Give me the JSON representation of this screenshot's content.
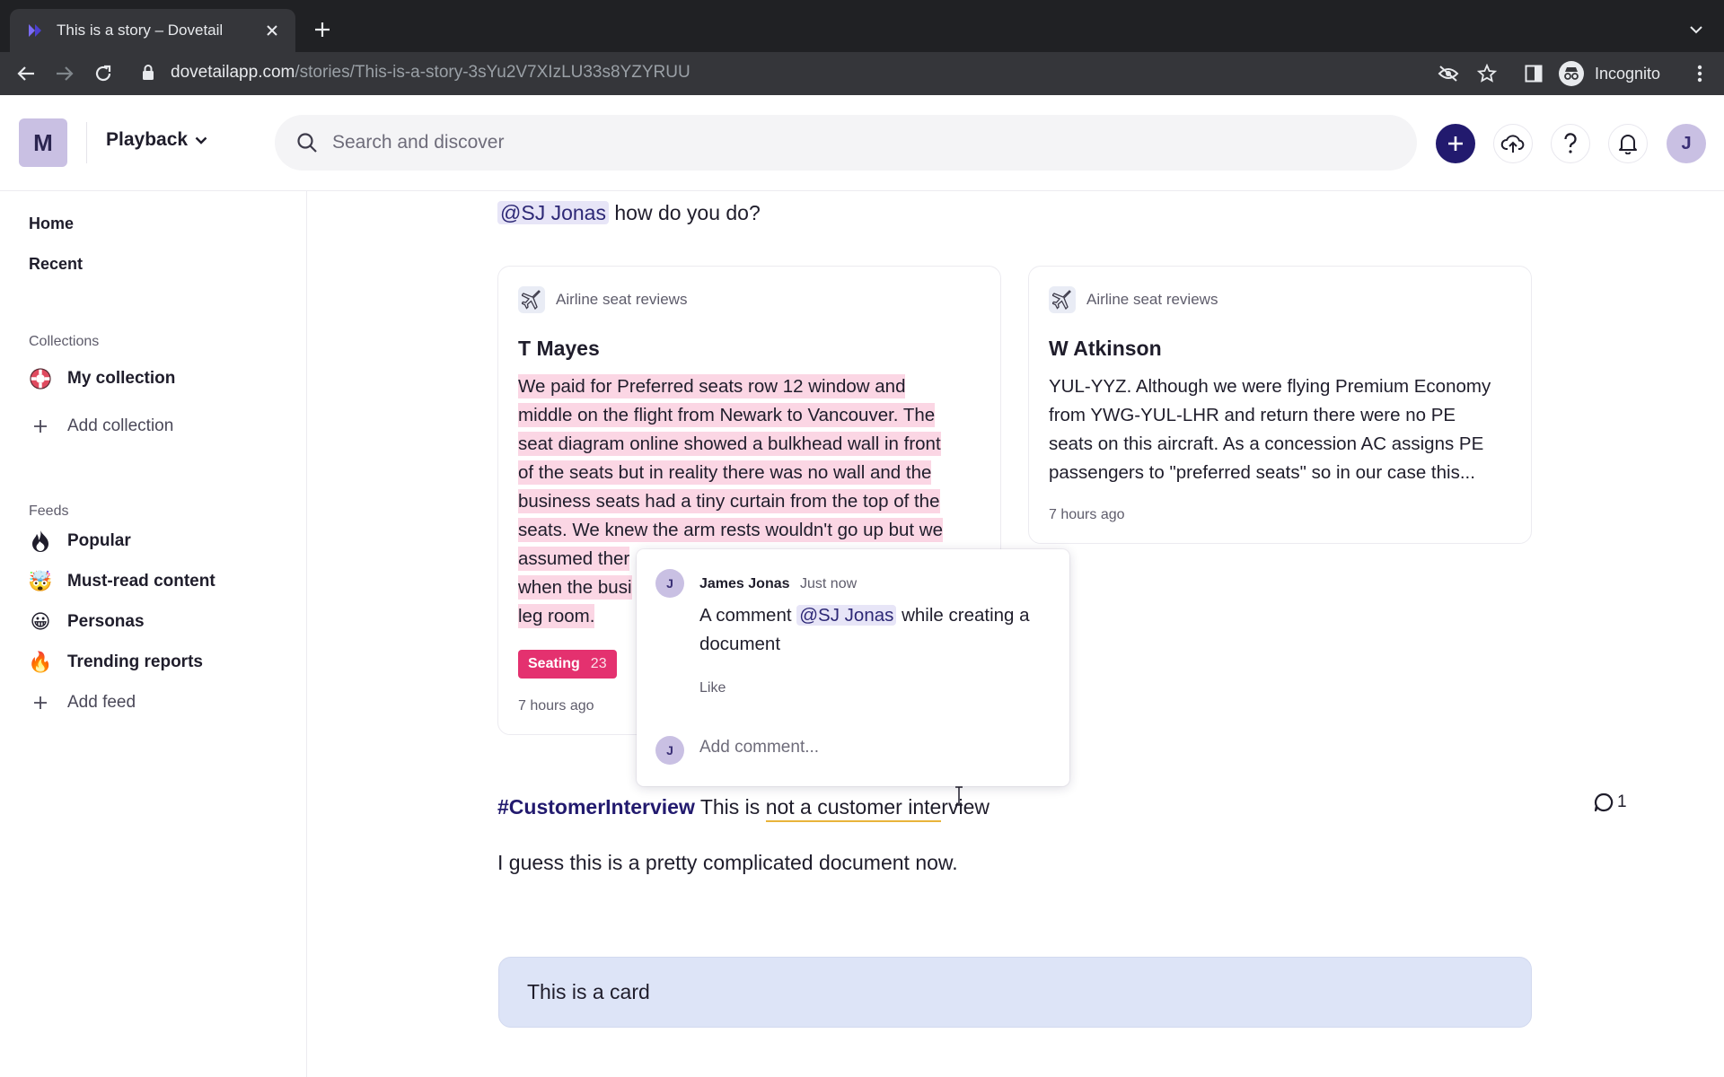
{
  "browser": {
    "tab_title": "This is a story – Dovetail",
    "url_domain": "dovetailapp.com",
    "url_path": "/stories/This-is-a-story-3sYu2V7XIzLU33s8YZYRUU",
    "incognito_label": "Incognito"
  },
  "header": {
    "workspace_initial": "M",
    "workspace_name": "Playback",
    "search_placeholder": "Search and discover",
    "user_initial": "J",
    "colors": {
      "primary": "#221a6e",
      "avatar": "#c9c0e3"
    }
  },
  "sidebar": {
    "top_links": [
      {
        "label": "Home"
      },
      {
        "label": "Recent"
      }
    ],
    "collections_heading": "Collections",
    "collections": [
      {
        "label": "My collection",
        "icon": "lifebuoy-icon"
      }
    ],
    "add_collection": "Add collection",
    "feeds_heading": "Feeds",
    "feeds": [
      {
        "label": "Popular",
        "icon": "flame-icon"
      },
      {
        "label": "Must-read content",
        "icon": "mind-blown-emoji-icon",
        "emoji": "🤯"
      },
      {
        "label": "Personas",
        "icon": "grinning-emoji-icon",
        "emoji": "😀"
      },
      {
        "label": "Trending reports",
        "icon": "fire-emoji-icon",
        "emoji": "🔥"
      }
    ],
    "add_feed": "Add feed"
  },
  "content": {
    "top_line": {
      "mention": "@SJ Jonas",
      "text": " how do you do?"
    },
    "cards": [
      {
        "source": "Airline seat reviews",
        "name": "T Mayes",
        "body_visible": [
          "We paid for Preferred seats row 12 window and",
          "middle on the flight from Newark to Vancouver. The",
          "seat diagram online showed a bulkhead wall in front",
          "of the seats but in reality there was no wall and the",
          "business seats had a tiny curtain from the top of the",
          "seats. We knew the arm rests wouldn't go up but we",
          "assumed ther",
          "when the busi",
          "leg room."
        ],
        "tag": {
          "label": "Seating",
          "count": "23",
          "color": "#e4316f"
        },
        "time": "7 hours ago"
      },
      {
        "source": "Airline seat reviews",
        "name": "W Atkinson",
        "body_lines": [
          "YUL-YYZ. Although we were flying Premium Economy",
          "from YWG-YUL-LHR and return there were no PE",
          "seats on this aircraft. As a concession AC assigns PE",
          "passengers to \"preferred seats\" so in our case this..."
        ],
        "time": "7 hours ago"
      }
    ],
    "comment_popover": {
      "author": "James Jonas",
      "author_initial": "J",
      "time": "Just now",
      "text_before": "A comment ",
      "mention": "@SJ Jonas",
      "text_after": " while creating a document",
      "like_label": "Like",
      "input_placeholder": "Add comment..."
    },
    "hashtag_line": {
      "hashtag": "#CustomerInterview",
      "text_before": " This is ",
      "commented_text": "not a customer inte",
      "text_after": "rview",
      "comment_count": "1"
    },
    "paragraph": "I guess this is a pretty complicated document now.",
    "card_block": "This is a card"
  }
}
